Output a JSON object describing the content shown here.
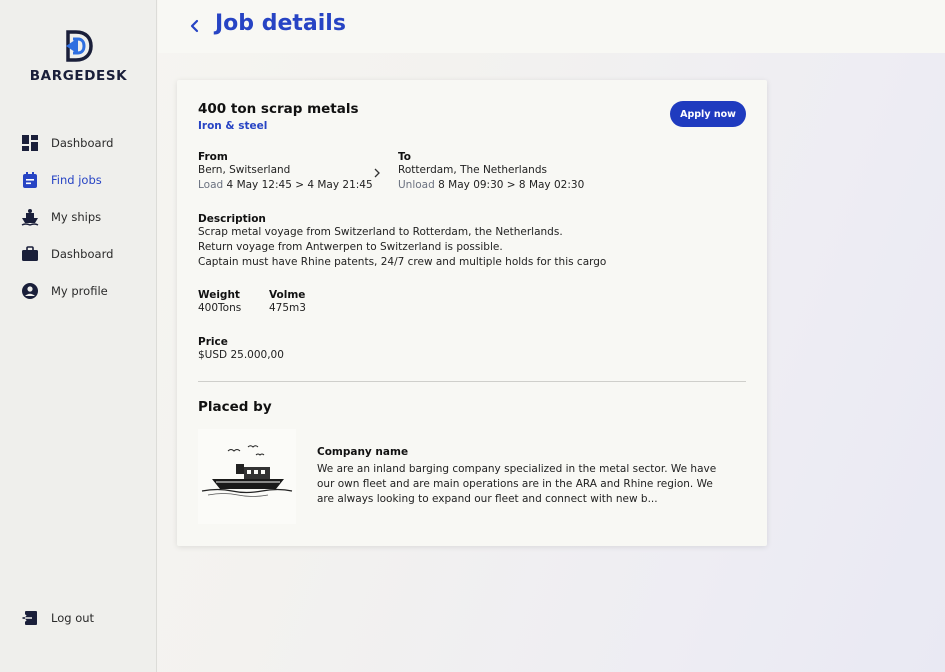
{
  "app": {
    "brand": "BARGEDESK"
  },
  "sidebar": {
    "items": [
      {
        "label": "Dashboard",
        "icon": "dashboard-icon"
      },
      {
        "label": "Find jobs",
        "icon": "clipboard-icon",
        "active": true
      },
      {
        "label": "My ships",
        "icon": "ship-icon"
      },
      {
        "label": "Dashboard",
        "icon": "briefcase-icon"
      },
      {
        "label": "My profile",
        "icon": "user-circle-icon"
      }
    ],
    "logout_label": "Log out"
  },
  "header": {
    "title": "Job details"
  },
  "job": {
    "title": "400 ton scrap metals",
    "category": "Iron & steel",
    "apply_label": "Apply now",
    "from": {
      "label": "From",
      "location": "Bern, Switserland",
      "window_prefix": "Load",
      "window": "4 May 12:45 > 4 May 21:45"
    },
    "to": {
      "label": "To",
      "location": "Rotterdam, The Netherlands",
      "window_prefix": "Unload",
      "window": "8 May 09:30 > 8 May 02:30"
    },
    "description": {
      "label": "Description",
      "lines": [
        "Scrap metal voyage from Switzerland to Rotterdam, the Netherlands.",
        "Return voyage from Antwerpen to Switzerland is possible.",
        "Captain must have Rhine patents, 24/7 crew and multiple holds for this cargo"
      ]
    },
    "weight": {
      "label": "Weight",
      "value": "400Tons"
    },
    "volume": {
      "label": "Volme",
      "value": "475m3"
    },
    "price": {
      "label": "Price",
      "value": "$USD 25.000,00"
    }
  },
  "placed_by": {
    "heading": "Placed by",
    "company_name": "Company name",
    "description": "We are an inland barging company specialized in the metal sector. We have our own fleet and are main operations are in the ARA and Rhine region. We are always looking to expand our fleet and connect with new b..."
  },
  "colors": {
    "accent": "#2744c4",
    "button": "#1f3bbf"
  }
}
